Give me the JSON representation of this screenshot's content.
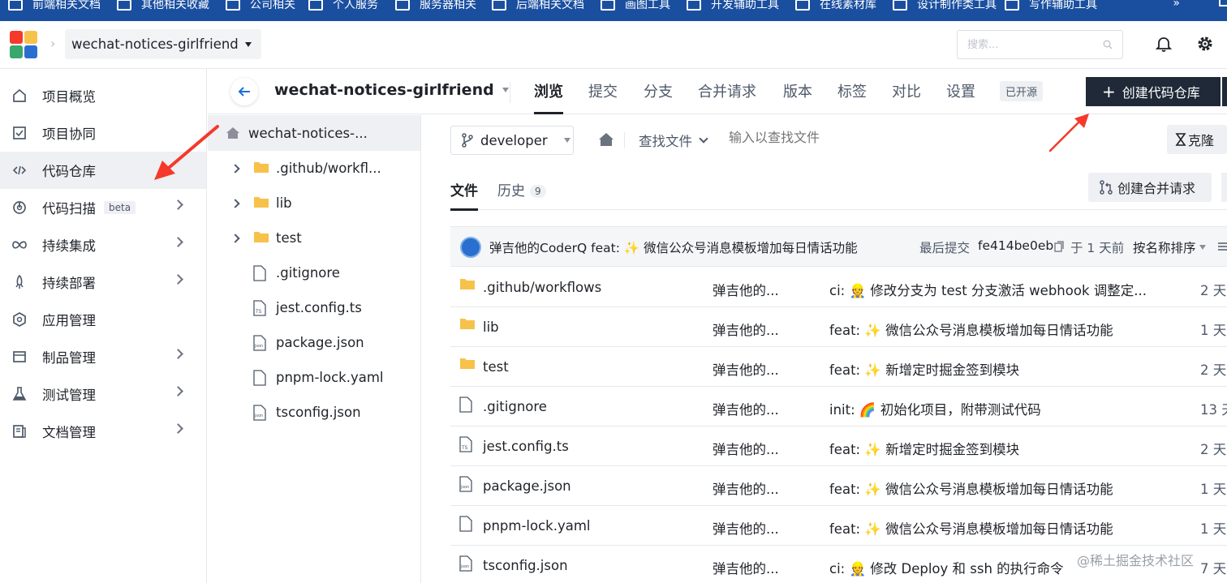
{
  "bookmarks": {
    "items": [
      "前端相关文档",
      "其他相关收藏",
      "公司相关",
      "个人服务",
      "服务器相关",
      "后端相关文档",
      "画图工具",
      "开发辅助工具",
      "在线素材库",
      "设计制作类工具",
      "写作辅助工具"
    ],
    "more": "»"
  },
  "topbar": {
    "project_name": "wechat-notices-girlfriend",
    "search_placeholder": "搜索..."
  },
  "sidebar": {
    "items": [
      {
        "label": "项目概览"
      },
      {
        "label": "项目协同"
      },
      {
        "label": "代码仓库"
      },
      {
        "label": "代码扫描",
        "badge": "beta"
      },
      {
        "label": "持续集成"
      },
      {
        "label": "持续部署"
      },
      {
        "label": "应用管理"
      },
      {
        "label": "制品管理"
      },
      {
        "label": "测试管理"
      },
      {
        "label": "文档管理"
      }
    ]
  },
  "repo": {
    "name": "wechat-notices-girlfriend",
    "tabs": [
      "浏览",
      "提交",
      "分支",
      "合并请求",
      "版本",
      "标签",
      "对比",
      "设置"
    ],
    "open_badge": "已开源",
    "create_button": "创建代码仓库"
  },
  "tree": {
    "root": "wechat-notices-...",
    "items": [
      {
        "name": ".github/workfl...",
        "type": "folder"
      },
      {
        "name": "lib",
        "type": "folder"
      },
      {
        "name": "test",
        "type": "folder"
      },
      {
        "name": ".gitignore",
        "type": "file"
      },
      {
        "name": "jest.config.ts",
        "type": "ts"
      },
      {
        "name": "package.json",
        "type": "json"
      },
      {
        "name": "pnpm-lock.yaml",
        "type": "file"
      },
      {
        "name": "tsconfig.json",
        "type": "json"
      }
    ]
  },
  "toolbar": {
    "branch": "developer",
    "find_file": "查找文件",
    "find_placeholder": "输入以查找文件",
    "clone": "克隆"
  },
  "subtabs": {
    "files": "文件",
    "history": "历史",
    "history_count": "9",
    "merge_button": "创建合并请求"
  },
  "commit": {
    "message": "弹吉他的CoderQ feat: ✨ 微信公众号消息模板增加每日情话功能",
    "last_label": "最后提交",
    "hash": "fe414be0eb",
    "time": "于 1 天前",
    "sort": "按名称排序"
  },
  "files": [
    {
      "name": ".github/workflows",
      "type": "folder",
      "author": "弹吉他的...",
      "commit": "ci: 👷 修改分支为 test 分支激活 webhook 调整定...",
      "time": "2 天"
    },
    {
      "name": "lib",
      "type": "folder",
      "author": "弹吉他的...",
      "commit": "feat: ✨ 微信公众号消息模板增加每日情话功能",
      "time": "1 天"
    },
    {
      "name": "test",
      "type": "folder",
      "author": "弹吉他的...",
      "commit": "feat: ✨ 新增定时掘金签到模块",
      "time": "2 天"
    },
    {
      "name": ".gitignore",
      "type": "file",
      "author": "弹吉他的...",
      "commit": "init: 🌈 初始化项目，附带测试代码",
      "time": "13 天"
    },
    {
      "name": "jest.config.ts",
      "type": "ts",
      "author": "弹吉他的...",
      "commit": "feat: ✨ 新增定时掘金签到模块",
      "time": "2 天"
    },
    {
      "name": "package.json",
      "type": "json",
      "author": "弹吉他的...",
      "commit": "feat: ✨ 微信公众号消息模板增加每日情话功能",
      "time": "1 天"
    },
    {
      "name": "pnpm-lock.yaml",
      "type": "file",
      "author": "弹吉他的...",
      "commit": "feat: ✨ 微信公众号消息模板增加每日情话功能",
      "time": "1 天"
    },
    {
      "name": "tsconfig.json",
      "type": "json",
      "author": "弹吉他的...",
      "commit": "ci: 👷 修改 Deploy 和 ssh 的执行命令",
      "time": "7 天"
    }
  ],
  "watermark": "@稀土掘金技术社区",
  "colors": {
    "accent": "#1f2937",
    "bookmark_bar": "#1a4fa0",
    "annotation": "#f5392a",
    "folder": "#f7c24a"
  }
}
